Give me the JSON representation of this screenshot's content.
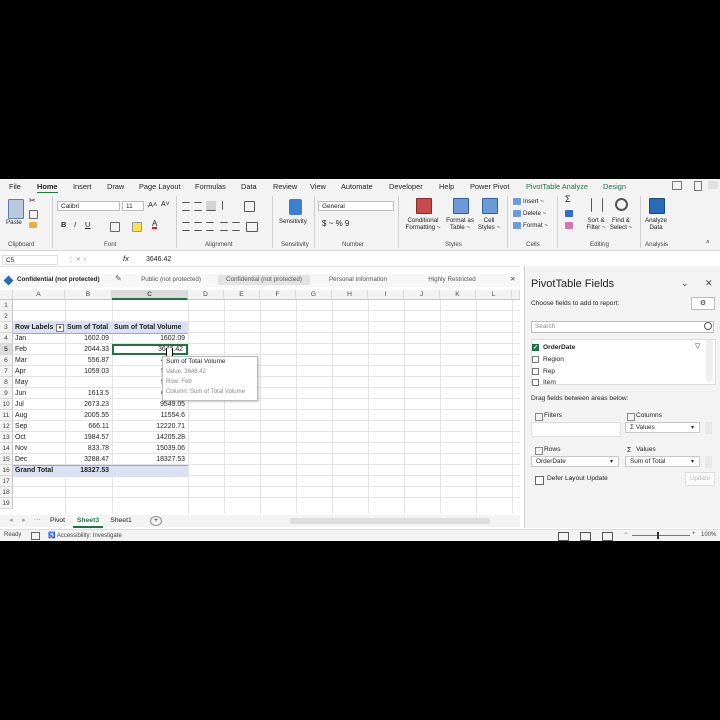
{
  "menu": [
    "File",
    "Home",
    "Insert",
    "Draw",
    "Page Layout",
    "Formulas",
    "Data",
    "Review",
    "View",
    "Automate",
    "Developer",
    "Help",
    "Power Pivot",
    "PivotTable Analyze",
    "Design"
  ],
  "ribbon": {
    "clipboard": {
      "paste": "Paste",
      "group": "Clipboard"
    },
    "font": {
      "name": "Calibri",
      "size": "11",
      "group": "Font"
    },
    "alignment": {
      "group": "Alignment"
    },
    "sensitivity": {
      "label": "Sensitivity",
      "group": "Sensitivity"
    },
    "number": {
      "format": "General",
      "symbols": "$ ~ % 9",
      "group": "Number"
    },
    "styles": {
      "conditional": "Conditional Formatting ~",
      "format_as_table": "Format as Table ~",
      "cell_styles": "Cell Styles ~",
      "group": "Styles"
    },
    "cells": {
      "insert": "Insert ~",
      "delete": "Delete ~",
      "format": "Format ~",
      "group": "Cells"
    },
    "editing": {
      "sort_filter": "Sort & Filter ~",
      "find_select": "Find & Select ~",
      "group": "Editing"
    },
    "analysis": {
      "analyze": "Analyze Data",
      "group": "Analysis"
    }
  },
  "formula_bar": {
    "name_box": "C5",
    "fx": "fx",
    "value": "3646.42"
  },
  "sensitivity_bar": {
    "current": "Confidential (not protected)",
    "options": [
      "Public (not protected)",
      "Confidential (not protected)",
      "Personal Information",
      "Highly Restricted"
    ]
  },
  "columns": [
    "A",
    "B",
    "C",
    "D",
    "E",
    "F",
    "G",
    "H",
    "I",
    "J",
    "K",
    "L"
  ],
  "rows": [
    "1",
    "2",
    "3",
    "4",
    "5",
    "6",
    "7",
    "8",
    "9",
    "10",
    "11",
    "12",
    "13",
    "14",
    "15",
    "16",
    "17",
    "18",
    "19"
  ],
  "pivot": {
    "headers": [
      "Row Labels",
      "Sum of Total",
      "Sum of Total Volume"
    ],
    "data": [
      [
        "Jan",
        "1602.09",
        "1602.09"
      ],
      [
        "Feb",
        "2044.33",
        "3646.42"
      ],
      [
        "Mar",
        "556.87",
        "4"
      ],
      [
        "Apr",
        "1059.03",
        "5"
      ],
      [
        "May",
        "",
        "5"
      ],
      [
        "Jun",
        "1613.5",
        "6"
      ],
      [
        "Jul",
        "2673.23",
        "9549.05"
      ],
      [
        "Aug",
        "2005.55",
        "11554.6"
      ],
      [
        "Sep",
        "666.11",
        "12220.71"
      ],
      [
        "Oct",
        "1984.57",
        "14205.28"
      ],
      [
        "Nov",
        "833.78",
        "15039.06"
      ],
      [
        "Dec",
        "3288.47",
        "18327.53"
      ]
    ],
    "grand_total": [
      "Grand Total",
      "18327.53",
      ""
    ]
  },
  "tooltip": {
    "title": "Sum of Total Volume",
    "value": "Value: 3646.42",
    "row": "Row: Feb",
    "column": "Column: Sum of Total Volume"
  },
  "sheet_tabs": [
    "Pivot",
    "Sheet3",
    "Sheet1"
  ],
  "status": {
    "ready": "Ready",
    "accessibility": "Accessibility: Investigate",
    "zoom": "100%"
  },
  "pivot_pane": {
    "title": "PivotTable Fields",
    "subtitle": "Choose fields to add to report:",
    "search_placeholder": "Search",
    "fields": [
      {
        "name": "OrderDate",
        "checked": true
      },
      {
        "name": "Region",
        "checked": false
      },
      {
        "name": "Rep",
        "checked": false
      },
      {
        "name": "Item",
        "checked": false
      }
    ],
    "drag_text": "Drag fields between areas below:",
    "filters": "Filters",
    "columns": "Columns",
    "rows": "Rows",
    "values": "Values",
    "columns_value": "Σ Values",
    "rows_value": "OrderDate",
    "values_value": "Sum of Total",
    "defer": "Defer Layout Update",
    "update": "Update"
  },
  "colors": {
    "accent": "#217346",
    "selection": "#d9e1f2"
  }
}
